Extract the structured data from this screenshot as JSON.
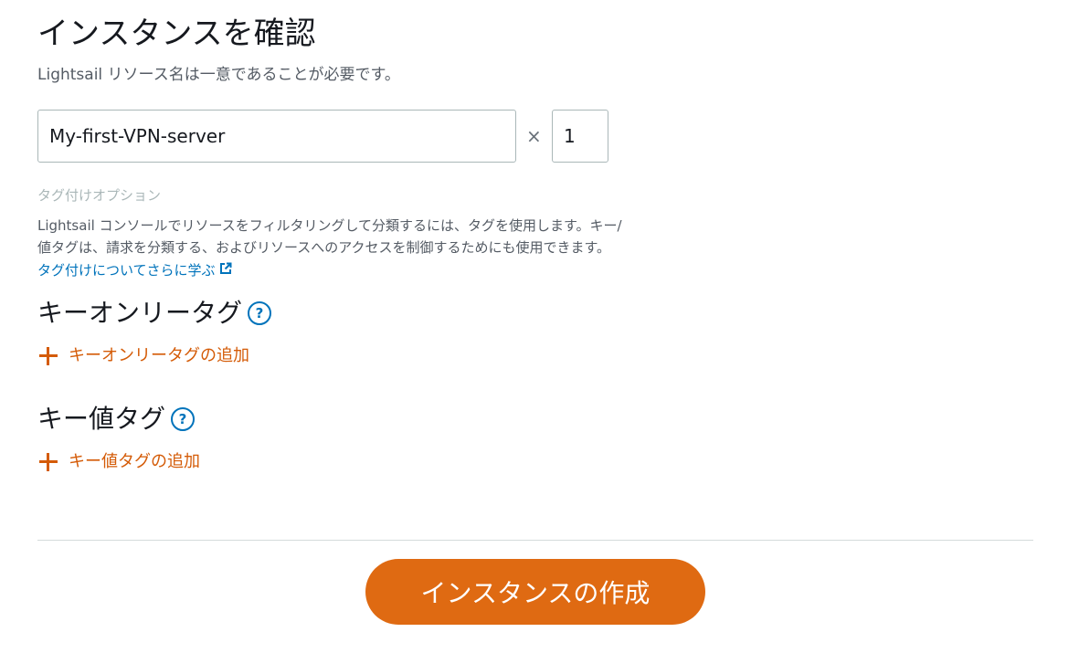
{
  "page": {
    "title": "インスタンスを確認",
    "subtitle": "Lightsail リソース名は一意であることが必要です。"
  },
  "instance": {
    "name_value": "My-first-VPN-server",
    "times_symbol": "×",
    "count_value": "1"
  },
  "tagging": {
    "caption": "タグ付けオプション",
    "description_line1": "Lightsail コンソールでリソースをフィルタリングして分類するには、タグを使用します。キー/",
    "description_line2": "値タグは、請求を分類する、およびリソースへのアクセスを制御するためにも使用できます。",
    "learn_more": "タグ付けについてさらに学ぶ",
    "key_only": {
      "heading": "キーオンリータグ",
      "add_label": "キーオンリータグの追加"
    },
    "key_value": {
      "heading": "キー値タグ",
      "add_label": "キー値タグの追加"
    },
    "help_glyph": "?"
  },
  "actions": {
    "create_label": "インスタンスの作成"
  },
  "colors": {
    "accent_orange": "#df6a12",
    "link_orange": "#d45b07",
    "link_blue": "#0073bb"
  },
  "icons": {
    "external": "external-link-icon",
    "help": "help-icon",
    "add": "plus-icon"
  }
}
